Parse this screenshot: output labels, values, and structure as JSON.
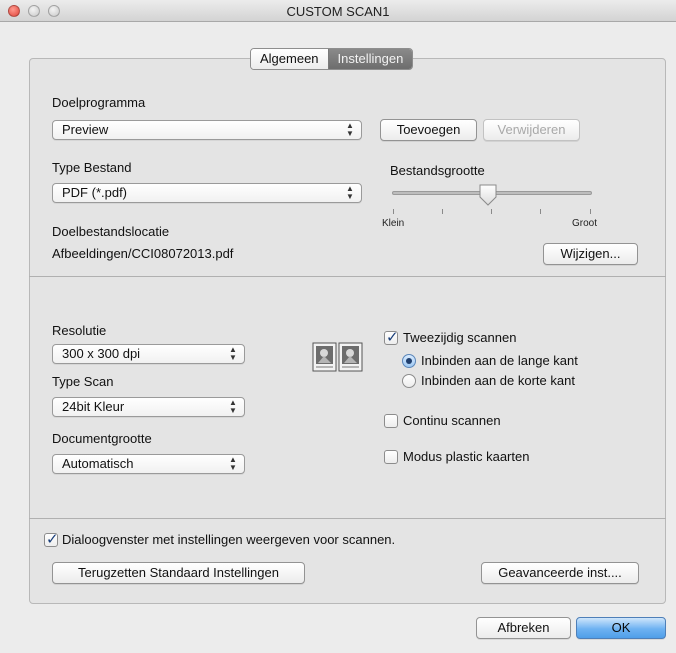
{
  "window": {
    "title": "CUSTOM SCAN1"
  },
  "tabs": [
    {
      "label": "Algemeen",
      "selected": false
    },
    {
      "label": "Instellingen",
      "selected": true
    }
  ],
  "target": {
    "label": "Doelprogramma",
    "value": "Preview",
    "add_button": "Toevoegen",
    "remove_button": "Verwijderen"
  },
  "filetype": {
    "label": "Type Bestand",
    "value": "PDF (*.pdf)"
  },
  "filesize": {
    "label": "Bestandsgrootte",
    "min_label": "Klein",
    "max_label": "Groot",
    "level": 0.48
  },
  "destination": {
    "label": "Doelbestandslocatie",
    "path": "Afbeeldingen/CCI08072013.pdf",
    "change_button": "Wijzigen..."
  },
  "resolution": {
    "label": "Resolutie",
    "value": "300 x 300 dpi"
  },
  "scantype": {
    "label": "Type Scan",
    "value": "24bit Kleur"
  },
  "docsize": {
    "label": "Documentgrootte",
    "value": "Automatisch"
  },
  "duplex": {
    "label": "Tweezijdig scannen",
    "checked": true,
    "long_edge": "Inbinden aan de lange kant",
    "short_edge": "Inbinden aan de korte kant",
    "selected": "long_edge"
  },
  "continuous": {
    "label": "Continu scannen",
    "checked": false
  },
  "plastic": {
    "label": "Modus plastic kaarten",
    "checked": false
  },
  "show_dialog": {
    "label": "Dialoogvenster met instellingen weergeven voor scannen.",
    "checked": true
  },
  "buttons": {
    "reset": "Terugzetten Standaard Instellingen",
    "advanced": "Geavanceerde inst....",
    "cancel": "Afbreken",
    "ok": "OK"
  },
  "colors": {
    "accent": "#4f9ee9",
    "window_bg": "#ececec"
  }
}
